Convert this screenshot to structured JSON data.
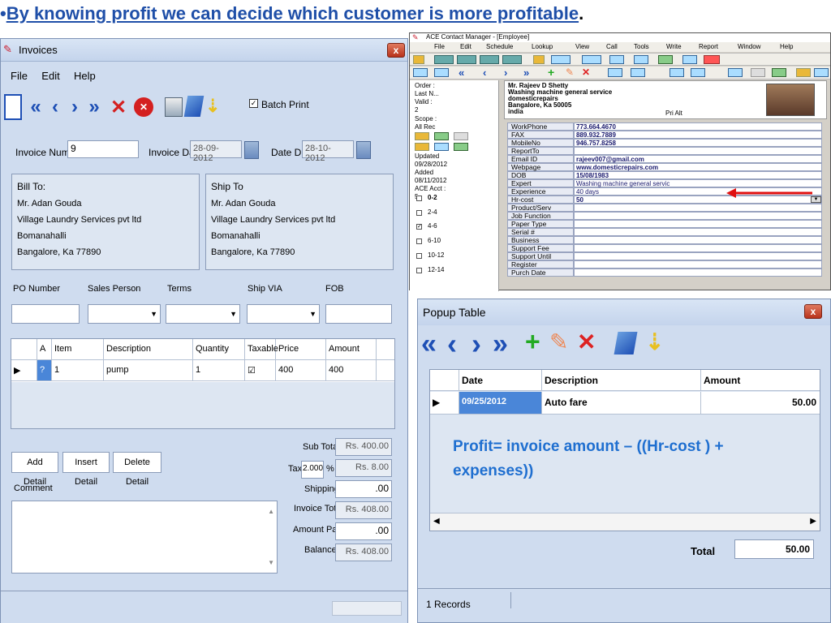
{
  "slide": {
    "bullet": "•",
    "headline": "By knowing  profit we can decide which customer is  more profitable",
    "period": "."
  },
  "invoices": {
    "title": "Invoices",
    "close": "x",
    "menu": [
      "File",
      "Edit",
      "Help"
    ],
    "batch_print": "Batch Print",
    "invoice_number_label": "Invoice Number",
    "invoice_number": "9",
    "invoice_date_label": "Invoice Date",
    "invoice_date": "28-09-2012",
    "date_due_label": "Date Due",
    "date_due": "28-10-2012",
    "bill_to_label": "Bill To:",
    "bill_to": [
      "Mr. Adan Gouda",
      "Village Laundry Services pvt ltd",
      "Bomanahalli",
      "Bangalore, Ka 77890"
    ],
    "ship_to_label": "Ship To",
    "ship_to": [
      "Mr. Adan Gouda",
      "Village Laundry Services pvt ltd",
      "Bomanahalli",
      "Bangalore, Ka 77890"
    ],
    "po_number_label": "PO Number",
    "sales_person_label": "Sales Person",
    "terms_label": "Terms",
    "ship_via_label": "Ship VIA",
    "fob_label": "FOB",
    "table_headers": [
      "A",
      "Item",
      "Description",
      "Quantity",
      "Taxable",
      "Price",
      "Amount"
    ],
    "row": {
      "indicator": "▶",
      "a": "?",
      "item": "1",
      "description": "pump",
      "quantity": "1",
      "taxable": "☑",
      "price": "400",
      "amount": "400"
    },
    "add_detail": "Add Detail",
    "insert_detail": "Insert Detail",
    "delete_detail": "Delete Detail",
    "comment_label": "Comment",
    "sub_total_label": "Sub Total",
    "sub_total": "Rs. 400.00",
    "tax_label": "Tax",
    "tax_rate": "2.000",
    "percent": "%",
    "tax_amount": "Rs. 8.00",
    "shipping_label": "Shipping",
    "shipping": ".00",
    "invoice_total_label": "Invoice Total",
    "invoice_total": "Rs. 408.00",
    "amount_paid_label": "Amount Paid",
    "amount_paid": ".00",
    "balance_label": "Balance",
    "balance": "Rs. 408.00"
  },
  "ace": {
    "title": "ACE Contact Manager - [Employee]",
    "menu": [
      "File",
      "Edit",
      "Schedule",
      "Lookup",
      "View",
      "Call",
      "Tools",
      "Write",
      "Report",
      "Window",
      "Help"
    ],
    "left": [
      "Order :",
      "Last N...",
      "Valid :",
      "2",
      "Scope :",
      "All Rec"
    ],
    "updated_label": "Updated",
    "updated": "09/28/2012",
    "added_label": "Added",
    "added": "08/11/2012",
    "acct_label": "ACE Acct :",
    "acct": "5",
    "ranges": [
      "0-2",
      "2-4",
      "4-6",
      "6-10",
      "10-12",
      "12-14"
    ],
    "contact": [
      "Mr. Rajeev D Shetty",
      "Washing machine general service",
      "domesticrepairs",
      "Bangalore, Ka 50005",
      "india"
    ],
    "pri_alt": "Pri  Alt",
    "fields": [
      {
        "label": "WorkPhone",
        "value": "773.664.4670"
      },
      {
        "label": "FAX",
        "value": "889.932.7889"
      },
      {
        "label": "MobileNo",
        "value": "946.757.8258"
      },
      {
        "label": "ReportTo",
        "value": ""
      },
      {
        "label": "Email ID",
        "value": "rajeev007@gmail.com"
      },
      {
        "label": "Webpage",
        "value": "www.domesticrepairs.com"
      },
      {
        "label": "DOB",
        "value": "15/08/1983"
      },
      {
        "label": "Expert",
        "value": "Washing machine general servic"
      },
      {
        "label": "Experience",
        "value": "40 days"
      },
      {
        "label": "Hr-cost",
        "value": "50"
      },
      {
        "label": "Product/Serv",
        "value": ""
      },
      {
        "label": "Job Function",
        "value": ""
      },
      {
        "label": "Paper Type",
        "value": ""
      },
      {
        "label": "Serial #",
        "value": ""
      },
      {
        "label": "Business",
        "value": ""
      },
      {
        "label": "Support Fee",
        "value": ""
      },
      {
        "label": "Support Until",
        "value": ""
      },
      {
        "label": "Register",
        "value": ""
      },
      {
        "label": "Purch Date",
        "value": ""
      }
    ]
  },
  "popup": {
    "title": "Popup Table",
    "close": "x",
    "headers": [
      "Date",
      "Description",
      "Amount"
    ],
    "row": {
      "indicator": "▶",
      "date": "09/25/2012",
      "description": "Auto fare",
      "amount": "50.00"
    },
    "formula": "Profit= invoice amount – ((Hr-cost ) + expenses))",
    "total_label": "Total",
    "total": "50.00",
    "records": "1 Records"
  }
}
